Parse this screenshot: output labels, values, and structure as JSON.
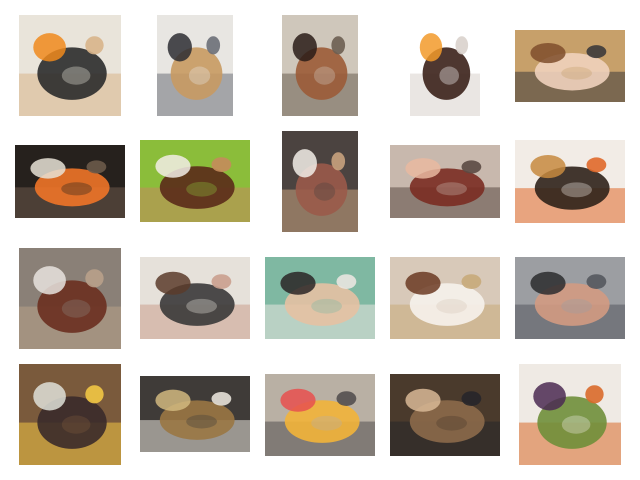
{
  "gallery": {
    "columns": 5,
    "rows": 4,
    "thumbnails": [
      {
        "subject": "collage-oranges-pie-cake",
        "colors": [
          "#e9e4da",
          "#f08a1c",
          "#2b2b2b",
          "#d8b48a"
        ]
      },
      {
        "subject": "man-holding-tray-of-food",
        "colors": [
          "#e8e6e2",
          "#2d2d33",
          "#c89a62",
          "#6b6f78"
        ]
      },
      {
        "subject": "chocolate-cookies-plate",
        "colors": [
          "#cfc7bb",
          "#2a1c17",
          "#9b5b37",
          "#6c5e52"
        ]
      },
      {
        "subject": "chocolate-truffles-orange",
        "colors": [
          "#ffffff",
          "#f29a2a",
          "#3b2119",
          "#d9d2cc"
        ]
      },
      {
        "subject": "man-eating-snack",
        "colors": [
          "#c7a06a",
          "#7f4d2b",
          "#f0d2bd",
          "#3c3a3b"
        ]
      },
      {
        "subject": "chopping-carrots",
        "colors": [
          "#26211d",
          "#e8e2d6",
          "#ef7428",
          "#6c5a4a"
        ]
      },
      {
        "subject": "dessert-on-green-placemat",
        "colors": [
          "#8bbd3a",
          "#f2ede6",
          "#5a2a1a",
          "#c48b5c"
        ]
      },
      {
        "subject": "cake-slice-plates",
        "colors": [
          "#4b4340",
          "#f2ede7",
          "#9a5a4a",
          "#c8a27d"
        ]
      },
      {
        "subject": "closeup-eating-food",
        "colors": [
          "#c8b8ad",
          "#e9b9a0",
          "#7a2c22",
          "#5b4a44"
        ]
      },
      {
        "subject": "donuts-with-sprinkles",
        "colors": [
          "#f2ece6",
          "#c78a3e",
          "#2f2219",
          "#e0692a"
        ]
      },
      {
        "subject": "plated-dinner-drink",
        "colors": [
          "#8a8077",
          "#e8e3de",
          "#6a2f1f",
          "#b8a089"
        ]
      },
      {
        "subject": "woman-with-glasses",
        "colors": [
          "#e6e1da",
          "#5a3b2a",
          "#3a3939",
          "#caa08e"
        ]
      },
      {
        "subject": "woman-eating-donut",
        "colors": [
          "#7fb8a2",
          "#2a2426",
          "#e5c1a3",
          "#e9e6e0"
        ]
      },
      {
        "subject": "donut-on-paper-bags",
        "colors": [
          "#d8c9b9",
          "#6b3a22",
          "#f6f2ec",
          "#c8aa7a"
        ]
      },
      {
        "subject": "man-at-keyboard",
        "colors": [
          "#9c9ea2",
          "#2b2b2e",
          "#d39a82",
          "#55585e"
        ]
      },
      {
        "subject": "cooking-pot-tacos",
        "colors": [
          "#7a5a3c",
          "#dfe0d8",
          "#3a2a2a",
          "#f2c744"
        ]
      },
      {
        "subject": "muffins-in-tin",
        "colors": [
          "#3f3b38",
          "#d1b87f",
          "#9a7744",
          "#e6e1d8"
        ]
      },
      {
        "subject": "kitchen-stove-cooking",
        "colors": [
          "#b9b0a4",
          "#e8504f",
          "#f2b43a",
          "#545050"
        ]
      },
      {
        "subject": "man-with-cardboard-box",
        "colors": [
          "#4a3a2c",
          "#d8b896",
          "#8c6a4a",
          "#27262a"
        ]
      },
      {
        "subject": "plate-with-greens-berries",
        "colors": [
          "#efeae4",
          "#4b2a52",
          "#6f8f3a",
          "#d96a2a"
        ]
      }
    ]
  }
}
